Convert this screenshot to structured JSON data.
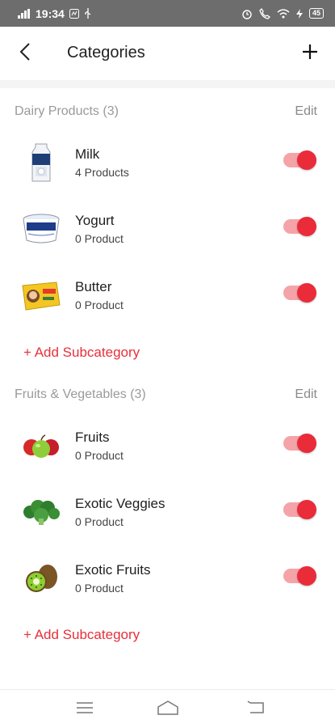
{
  "status_bar": {
    "time": "19:34",
    "battery": "45"
  },
  "header": {
    "title": "Categories"
  },
  "sections": [
    {
      "title": "Dairy Products (3)",
      "edit_label": "Edit",
      "items": [
        {
          "name": "Milk",
          "count": "4 Products",
          "enabled": true,
          "icon": "milk-carton-icon"
        },
        {
          "name": "Yogurt",
          "count": "0 Product",
          "enabled": true,
          "icon": "yogurt-cup-icon"
        },
        {
          "name": "Butter",
          "count": "0 Product",
          "enabled": true,
          "icon": "butter-pack-icon"
        }
      ],
      "add_label": "+ Add Subcategory"
    },
    {
      "title": "Fruits & Vegetables (3)",
      "edit_label": "Edit",
      "items": [
        {
          "name": "Fruits",
          "count": "0 Product",
          "enabled": true,
          "icon": "fruits-icon"
        },
        {
          "name": "Exotic Veggies",
          "count": "0 Product",
          "enabled": true,
          "icon": "broccoli-icon"
        },
        {
          "name": "Exotic Fruits",
          "count": "0 Product",
          "enabled": true,
          "icon": "kiwi-icon"
        }
      ],
      "add_label": "+ Add Subcategory"
    }
  ],
  "colors": {
    "accent": "#e5303a",
    "toggle_track": "#f4a4a9",
    "status_bar": "#6d6d6d"
  }
}
